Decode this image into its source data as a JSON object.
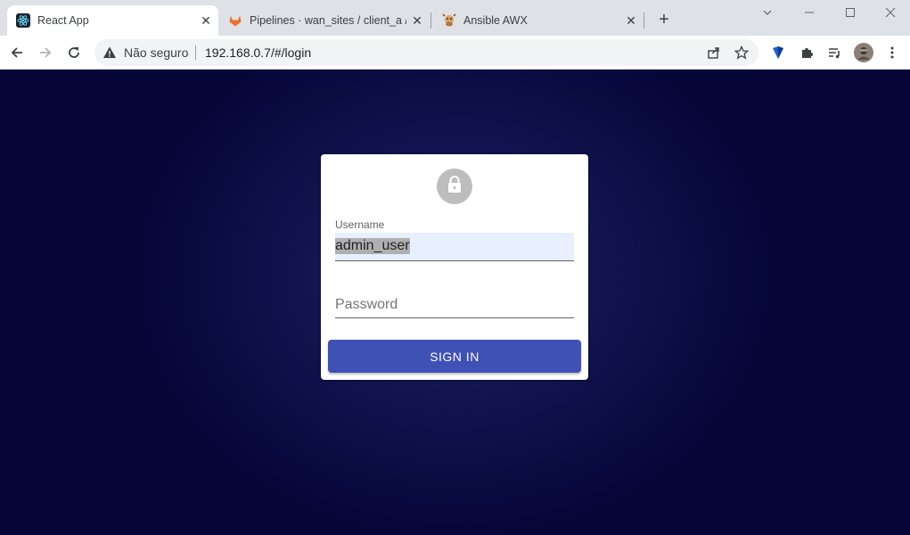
{
  "browser": {
    "tabs": [
      {
        "title": "React App",
        "icon": "react-icon",
        "active": true
      },
      {
        "title": "Pipelines · wan_sites / client_a / s",
        "icon": "gitlab-icon",
        "active": false
      },
      {
        "title": "Ansible AWX",
        "icon": "awx-icon",
        "active": false
      }
    ],
    "new_tab": "+",
    "address": {
      "security_label": "Não seguro",
      "url": "192.168.0.7/#/login"
    }
  },
  "login": {
    "username_label": "Username",
    "username_value": "admin_user",
    "password_placeholder": "Password",
    "signin_label": "SIGN IN"
  },
  "colors": {
    "page_bg": "#050538",
    "button": "#3f51b5",
    "autofill": "#e8f0fe"
  }
}
